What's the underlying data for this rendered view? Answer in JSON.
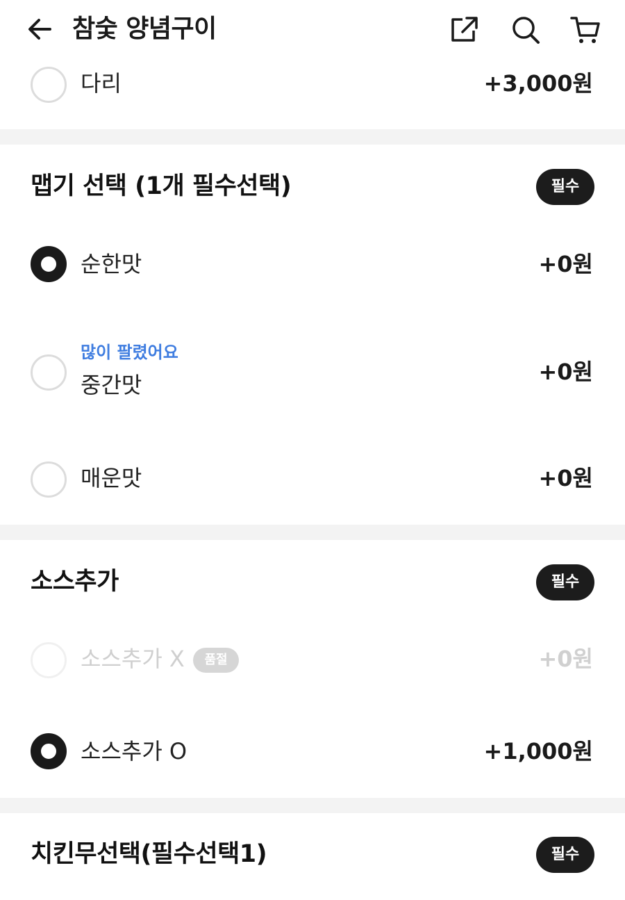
{
  "header": {
    "title": "참숯 양념구이",
    "icons": [
      "back-arrow-icon",
      "share-icon",
      "search-icon",
      "cart-icon"
    ]
  },
  "prev_option": {
    "label": "다리",
    "price": "+3,000원",
    "selected": false
  },
  "sections": [
    {
      "title": "맵기 선택 (1개 필수선택)",
      "badge": "필수",
      "options": [
        {
          "label": "순한맛",
          "price": "+0원",
          "selected": true
        },
        {
          "tag": "많이 팔렸어요",
          "label": "중간맛",
          "price": "+0원",
          "selected": false
        },
        {
          "label": "매운맛",
          "price": "+0원",
          "selected": false
        }
      ]
    },
    {
      "title": "소스추가",
      "badge": "필수",
      "options": [
        {
          "label": "소스추가 X",
          "soldout": "품절",
          "price": "+0원",
          "selected": false,
          "disabled": true
        },
        {
          "label": "소스추가 O",
          "price": "+1,000원",
          "selected": true
        }
      ]
    },
    {
      "title": "치킨무선택(필수선택1)",
      "badge": "필수"
    }
  ],
  "colors": {
    "accent_blue": "#3f7de0",
    "dark": "#1a1a1a",
    "divider": "#f3f3f3"
  }
}
